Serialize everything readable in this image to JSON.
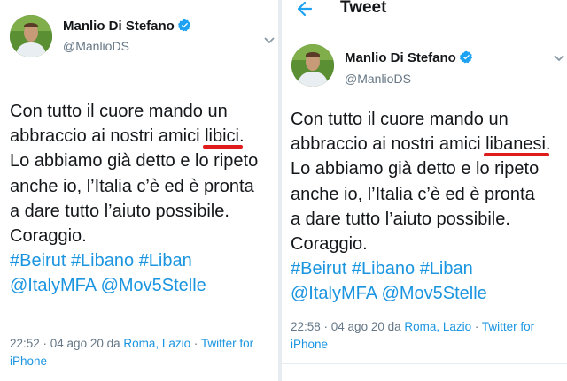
{
  "left_tweet": {
    "author_name": "Manlio Di Stefano",
    "handle": "@ManlioDS",
    "text_lines": [
      "Con tutto il cuore mando un",
      "abbraccio ai nostri amici ",
      "libici",
      ".",
      "Lo abbiamo già detto e lo ripeto",
      "anche io, l’Italia c’è ed è pronta",
      "a dare tutto l’aiuto possibile.",
      "Coraggio."
    ],
    "hashtags": [
      "#Beirut",
      "#Libano",
      "#Liban"
    ],
    "mentions": [
      "@ItalyMFA",
      "@Mov5Stelle"
    ],
    "meta": {
      "time_date": "22:52 · 04 ago 20 da ",
      "location": "Roma, Lazio",
      "separator": " · ",
      "client": "Twitter for iPhone"
    }
  },
  "right_tweet": {
    "header_title": "Tweet",
    "author_name": "Manlio Di Stefano",
    "handle": "@ManlioDS",
    "text_lines": [
      "Con tutto il cuore mando un",
      "abbraccio ai nostri amici ",
      "libanesi",
      ".",
      "Lo abbiamo già detto e lo ripeto",
      "anche io, l’Italia c’è ed è pronta",
      "a dare tutto l’aiuto possibile.",
      "Coraggio."
    ],
    "hashtags": [
      "#Beirut",
      "#Libano",
      "#Liban"
    ],
    "mentions": [
      "@ItalyMFA",
      "@Mov5Stelle"
    ],
    "meta": {
      "time_date": "22:58 · 04 ago 20 da ",
      "location": "Roma, Lazio",
      "separator": " · ",
      "client_line1": "Twitter for",
      "client_line2": "iPhone"
    }
  },
  "colors": {
    "link": "#1b95e0",
    "text": "#14171a",
    "muted": "#657786",
    "highlight": "#e01b1b"
  },
  "icons": [
    "back-arrow-icon",
    "verified-badge-icon",
    "chevron-down-icon"
  ]
}
